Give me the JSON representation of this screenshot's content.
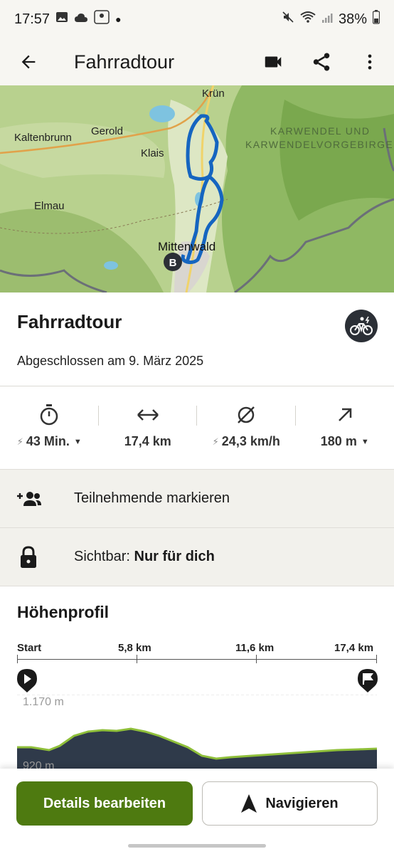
{
  "status": {
    "time": "17:57",
    "battery": "38%"
  },
  "appbar": {
    "title": "Fahrradtour"
  },
  "map": {
    "labels": {
      "krun": "Krün",
      "kaltenbrunn": "Kaltenbrunn",
      "gerold": "Gerold",
      "klais": "Klais",
      "elmau": "Elmau",
      "mittenwald": "Mittenwald",
      "karwendel1": "KARWENDEL UND",
      "karwendel2": "KARWENDELVORGEBIRGE",
      "marker": "B"
    }
  },
  "activity": {
    "title": "Fahrradtour",
    "completed": "Abgeschlossen am 9. März 2025",
    "sport_icon": "ebike-icon"
  },
  "stats": {
    "duration": "43 Min.",
    "distance": "17,4 km",
    "avg_speed": "24,3 km/h",
    "elevation": "180 m"
  },
  "rows": {
    "participants": "Teilnehmende markieren",
    "visibility_label": "Sichtbar:",
    "visibility_value": "Nur für dich"
  },
  "profile": {
    "title": "Höhenprofil",
    "scale": [
      "Start",
      "5,8 km",
      "11,6 km",
      "17,4 km"
    ],
    "elev_high": "1.170 m",
    "elev_low": "920 m"
  },
  "buttons": {
    "edit": "Details bearbeiten",
    "navigate": "Navigieren"
  },
  "colors": {
    "primary_green": "#4e7a10",
    "route_blue": "#1565c0",
    "profile_fill": "#2f3a4a",
    "profile_line": "#8fbf3a"
  }
}
